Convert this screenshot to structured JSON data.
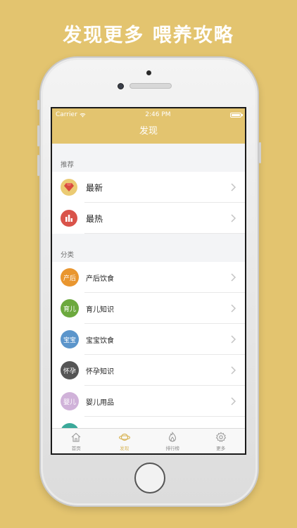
{
  "headline": "发现更多 喂养攻略",
  "status_bar": {
    "carrier": "Carrier",
    "time": "2:46 PM"
  },
  "nav_title": "发现",
  "recommend": {
    "header": "推荐",
    "items": [
      {
        "label": "最新",
        "icon": "gem-icon",
        "color": "#EBCB73"
      },
      {
        "label": "最热",
        "icon": "chart-icon",
        "color": "#D9534A"
      }
    ]
  },
  "category": {
    "header": "分类",
    "items": [
      {
        "badge": "产后",
        "label": "产后饮食",
        "color": "#E9962F"
      },
      {
        "badge": "育儿",
        "label": "育儿知识",
        "color": "#6CA93E"
      },
      {
        "badge": "宝宝",
        "label": "宝宝饮食",
        "color": "#5B95CB"
      },
      {
        "badge": "怀孕",
        "label": "怀孕知识",
        "color": "#555555"
      },
      {
        "badge": "婴儿",
        "label": "婴儿用品",
        "color": "#D0B2D9"
      }
    ]
  },
  "tabs": [
    {
      "label": "首页",
      "icon": "home-icon"
    },
    {
      "label": "发现",
      "icon": "planet-icon"
    },
    {
      "label": "排行榜",
      "icon": "flame-icon"
    },
    {
      "label": "更多",
      "icon": "gear-icon"
    }
  ]
}
